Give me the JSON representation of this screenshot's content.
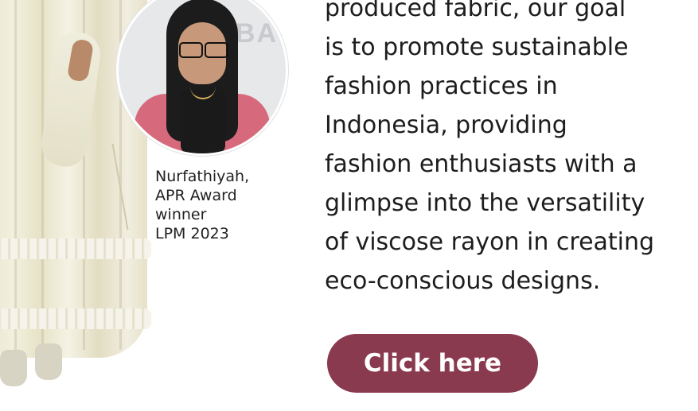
{
  "caption": {
    "lines": [
      "Nurfathiyah,",
      "APR Award",
      "winner",
      "LPM 2023"
    ]
  },
  "portrait": {
    "background_sign_text": "MBA"
  },
  "body": {
    "lines": [
      "produced fabric, our goal",
      "is to promote sustainable",
      "fashion practices in",
      "Indonesia, providing",
      "fashion enthusiasts with a",
      "glimpse into the versatility",
      "of viscose rayon in creating",
      "eco-conscious designs."
    ]
  },
  "cta": {
    "label": "Click here",
    "color": "#8a3a4e"
  }
}
